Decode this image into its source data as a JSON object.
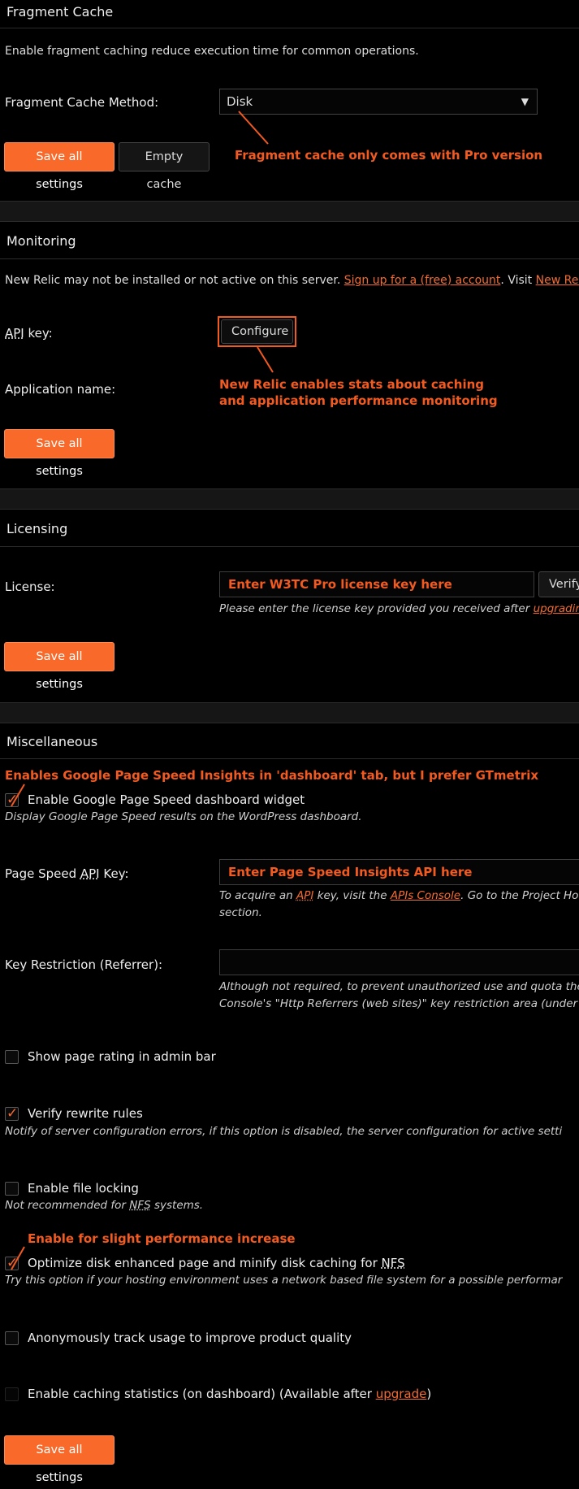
{
  "fragment_cache": {
    "title": "Fragment Cache",
    "description": "Enable fragment caching reduce execution time for common operations.",
    "method_label": "Fragment Cache Method:",
    "method_value": "Disk",
    "save_label": "Save all settings",
    "empty_cache_label": "Empty cache",
    "annotation": "Fragment cache only comes with Pro version"
  },
  "monitoring": {
    "title": "Monitoring",
    "desc_prefix": "New Relic may not be installed or not active on this server.",
    "signup_link": "Sign up for a (free) account",
    "desc_mid": ". Visit",
    "new_relic_link": "New Relic",
    "api_key_label_abbr": "API",
    "api_key_label_rest": " key:",
    "configure_label": "Configure",
    "app_name_label": "Application name:",
    "annotation_line1": "New Relic enables stats about caching",
    "annotation_line2": "and application performance monitoring",
    "save_label": "Save all settings"
  },
  "licensing": {
    "title": "Licensing",
    "license_label": "License:",
    "license_placeholder": "Enter W3TC Pro license key here",
    "verify_label": "Verify",
    "help_prefix": "Please enter the license key provided you received after",
    "help_link": "upgrading",
    "save_label": "Save all settings"
  },
  "misc": {
    "title": "Miscellaneous",
    "annotation_pagespeed": "Enables Google Page Speed Insights in 'dashboard' tab, but I prefer GTmetrix",
    "pagespeed_widget_label": "Enable Google Page Speed dashboard widget",
    "pagespeed_widget_desc": "Display Google Page Speed results on the WordPress dashboard.",
    "api_key_label_prefix": "Page Speed ",
    "api_key_label_abbr": "API",
    "api_key_label_suffix": " Key:",
    "api_key_placeholder": "Enter Page Speed Insights API here",
    "api_help_1": "To acquire an",
    "api_help_abbr": "API",
    "api_help_2": " key, visit the",
    "api_help_link": "APIs Console",
    "api_help_3": ". Go to the Project Ho",
    "api_help_line2": "section.",
    "key_restriction_label": "Key Restriction (Referrer):",
    "key_restriction_help_line1": "Although not required, to prevent unauthorized use and quota the",
    "key_restriction_help_line2": "Console's \"Http Referrers (web sites)\" key restriction area (under C",
    "show_rating_label": "Show page rating in admin bar",
    "verify_rewrite_label": "Verify rewrite rules",
    "verify_rewrite_desc": "Notify of server configuration errors, if this option is disabled, the server configuration for active setti",
    "file_locking_label": "Enable file locking",
    "file_locking_desc_prefix": "Not recommended for ",
    "file_locking_desc_abbr": "NFS",
    "file_locking_desc_suffix": " systems.",
    "annotation_nfs": "Enable for slight performance increase",
    "optimize_nfs_label_prefix": "Optimize disk enhanced page and minify disk caching for ",
    "optimize_nfs_label_abbr": "NFS",
    "optimize_nfs_desc": "Try this option if your hosting environment uses a network based file system for a possible performar",
    "track_usage_label": "Anonymously track usage to improve product quality",
    "stats_label_prefix": "Enable caching statistics (on dashboard)",
    "stats_label_mid": " (Available after ",
    "stats_link": "upgrade",
    "stats_label_suffix": ")",
    "save_label": "Save all settings"
  },
  "colors": {
    "accent": "#f96a2a",
    "annotation": "#f35a20",
    "background": "#000000",
    "link": "#f36b32"
  },
  "icons": {
    "select_caret": "▼",
    "checkmark": "✓"
  }
}
